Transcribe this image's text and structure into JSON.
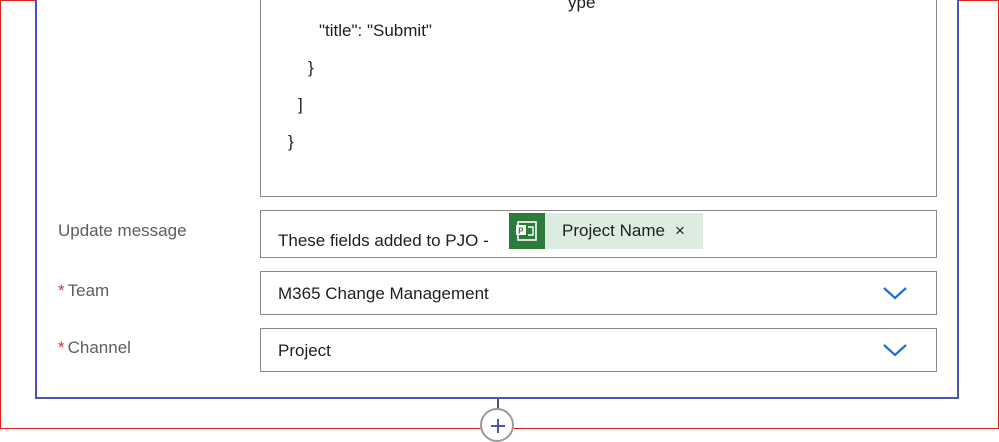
{
  "code": {
    "lines": [
      "\"title\": \"Submit\"",
      "}",
      "]",
      "}"
    ]
  },
  "update_message": {
    "label": "Update message",
    "prefix_text": "These fields added to PJO -",
    "token_label": "Project Name",
    "token_close": "×",
    "token_icon": "project-icon"
  },
  "team": {
    "required_mark": "*",
    "label": "Team",
    "value": "M365 Change Management"
  },
  "channel": {
    "required_mark": "*",
    "label": "Channel",
    "value": "Project"
  },
  "colors": {
    "card_border": "#4e53b8",
    "token_bg": "#dcece1",
    "token_icon_bg": "#2c7b3a",
    "chevron": "#1a6fd6",
    "required": "#d13438"
  }
}
